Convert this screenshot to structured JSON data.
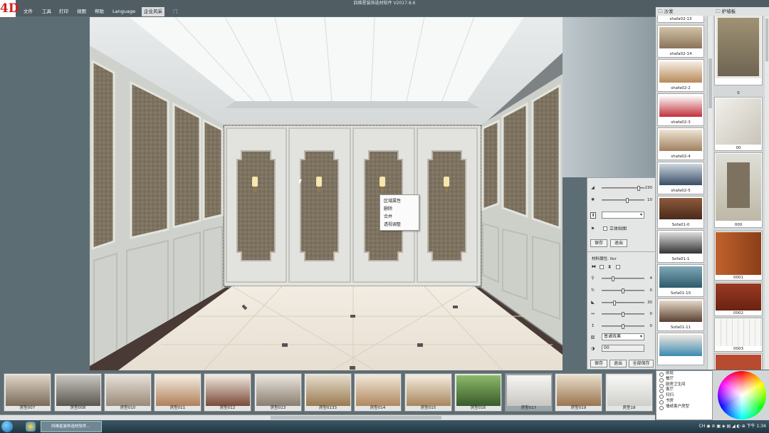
{
  "window": {
    "title": "四维星装饰选材软件 V2017.8.6",
    "logo": "4D"
  },
  "menu": {
    "items": [
      "文件",
      "工具",
      "打印",
      "视图",
      "帮助",
      "Language",
      "企业风采",
      "门"
    ]
  },
  "context_menu": {
    "items": [
      "区域属性",
      "删除",
      "合并",
      "透视调整"
    ]
  },
  "props": {
    "sliders1": [
      {
        "icon": "brightness-icon",
        "value": "230"
      },
      {
        "icon": "contrast-icon",
        "value": "10"
      }
    ],
    "upload_icon": "upload-icon",
    "checkbox_3d": "立体贴图",
    "save": "保存",
    "exit": "退出",
    "material_title": "材料属性: 0or",
    "sliders2": [
      {
        "icon": "zoom-icon",
        "value": "4"
      },
      {
        "icon": "rotate-icon",
        "value": "0"
      },
      {
        "icon": "light-icon",
        "value": "30"
      },
      {
        "icon": "horizontal-icon",
        "value": "0"
      },
      {
        "icon": "vertical-icon",
        "value": "0"
      }
    ],
    "effect_select": "普通效果",
    "angle_value": "00",
    "save2": "保存",
    "exit2": "退出",
    "save_all": "全部保存"
  },
  "catalog1": {
    "header": "沙发",
    "items": [
      "shafa02-13",
      "shafa02-14",
      "shafa02-2",
      "shafa02-3",
      "shafa02-4",
      "shafa02-5",
      "Sofa01-0",
      "Sofa01-1",
      "Sofa01-10",
      "Sofa01-11",
      ""
    ]
  },
  "catalog2": {
    "header": "护墙板",
    "items": [
      "",
      "0",
      "00",
      "000",
      "0001",
      "0002",
      "0003",
      ""
    ]
  },
  "rooms": {
    "items": [
      "房型007",
      "房型008",
      "房型010",
      "房型011",
      "房型012",
      "房型013",
      "房型0133",
      "房型014",
      "房型015",
      "房型016",
      "房型017",
      "房型019",
      "房型18"
    ],
    "selected": "房型017"
  },
  "room_types": {
    "items": [
      "前庭",
      "餐厅",
      "厨房卫生间",
      "客厅",
      "扫扫",
      "书房",
      "墙纸客户房型"
    ]
  },
  "taskbar": {
    "app_label": "四维星装饰选材软件...",
    "tray": "CH ◉ ⊘ ▣ ◈ ▤ ◢ ◐ ⊕    下午 1:34"
  },
  "colors": {
    "accent_red": "#d02020",
    "panel": "#e4e6e6",
    "ui_blue_gray": "#5d6d74"
  }
}
